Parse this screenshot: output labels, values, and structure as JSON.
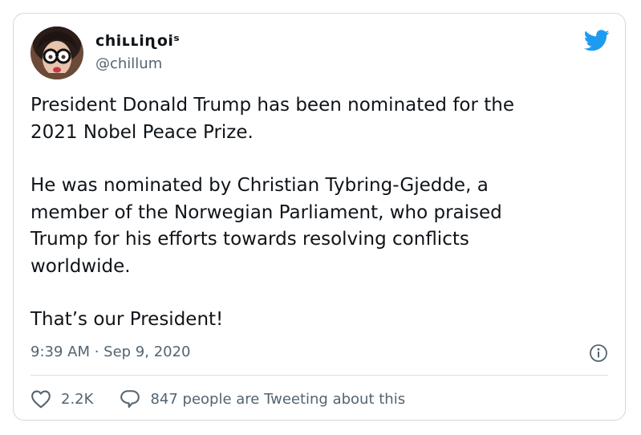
{
  "author": {
    "display_name": "ᴄhiʟʟiɳoiˢ",
    "handle": "@chillum"
  },
  "tweet": {
    "paragraphs": [
      "President Donald Trump has been nominated for the\n2021 Nobel Peace Prize.",
      "He was nominated by Christian Tybring-Gjedde, a\nmember of the Norwegian Parliament, who praised\nTrump for his efforts towards resolving conflicts\nworldwide.",
      "That’s our President!"
    ],
    "timestamp": "9:39 AM · Sep 9, 2020"
  },
  "actions": {
    "like_count": "2.2K",
    "reply_text": "847 people are Tweeting about this"
  },
  "icons": {
    "brand": "twitter-bird-icon",
    "info": "info-icon",
    "like": "heart-icon",
    "reply": "speech-bubble-icon"
  },
  "colors": {
    "brand": "#1d9bf0",
    "text": "#0f1419",
    "secondary": "#536471",
    "border": "#d0d8de"
  }
}
